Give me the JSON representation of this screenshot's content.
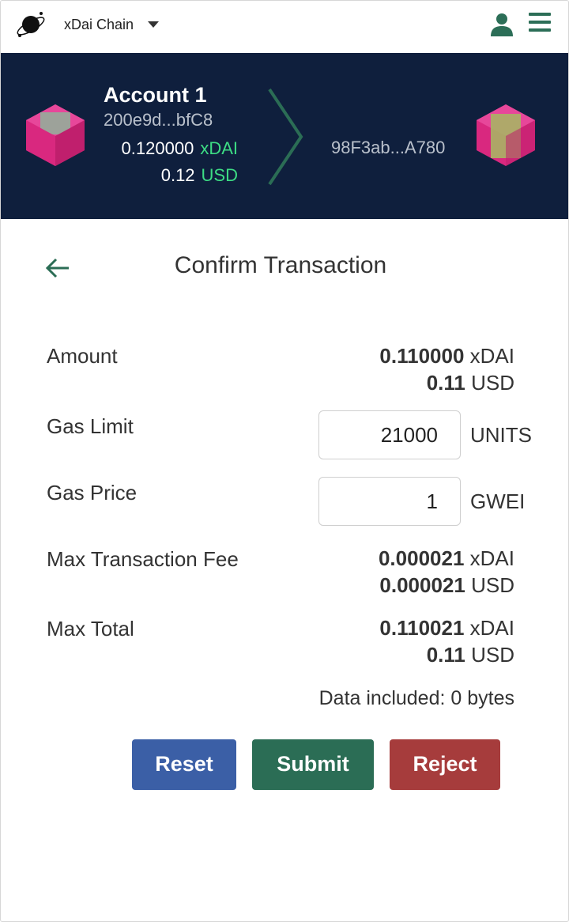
{
  "topbar": {
    "network_label": "xDai Chain"
  },
  "from_account": {
    "name": "Account 1",
    "address": "200e9d...bfC8",
    "balance_native": "0.120000",
    "native_unit": "xDAI",
    "balance_fiat": "0.12",
    "fiat_unit": "USD"
  },
  "to_account": {
    "address": "98F3ab...A780"
  },
  "page": {
    "title": "Confirm Transaction"
  },
  "amount": {
    "label": "Amount",
    "native_value": "0.110000",
    "native_unit": "xDAI",
    "fiat_value": "0.11",
    "fiat_unit": "USD"
  },
  "gas_limit": {
    "label": "Gas Limit",
    "value": "21000",
    "unit": "UNITS"
  },
  "gas_price": {
    "label": "Gas Price",
    "value": "1",
    "unit": "GWEI"
  },
  "max_fee": {
    "label": "Max Transaction Fee",
    "native_value": "0.000021",
    "native_unit": "xDAI",
    "fiat_value": "0.000021",
    "fiat_unit": "USD"
  },
  "max_total": {
    "label": "Max Total",
    "native_value": "0.110021",
    "native_unit": "xDAI",
    "fiat_value": "0.11",
    "fiat_unit": "USD"
  },
  "data_note": "Data included: 0 bytes",
  "buttons": {
    "reset": "Reset",
    "submit": "Submit",
    "reject": "Reject"
  },
  "colors": {
    "banner": "#0f1f3d",
    "accent_green": "#3ddc84",
    "reset": "#3b5fa6",
    "submit": "#2b6d55",
    "reject": "#a63c3c"
  }
}
